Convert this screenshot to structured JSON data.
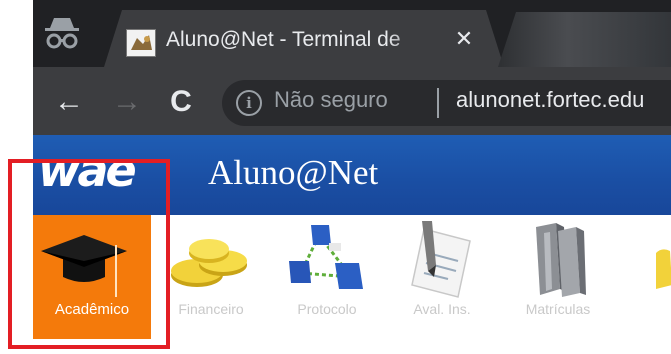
{
  "browser": {
    "tab": {
      "title": "Aluno@Net - Terminal de",
      "close_glyph": "✕",
      "favicon": "app-favicon-icon"
    },
    "nav": {
      "back_glyph": "←",
      "forward_glyph": "→",
      "reload_glyph": "C"
    },
    "address_bar": {
      "info_glyph": "i",
      "security_label": "Não seguro",
      "url": "alunonet.fortec.edu"
    }
  },
  "app": {
    "logo_text": "wae",
    "title": "Aluno@Net",
    "header_color": "#1a4ea3"
  },
  "menu": {
    "items": [
      {
        "label": "Acadêmico",
        "icon": "graduation-cap-icon",
        "active": true
      },
      {
        "label": "Financeiro",
        "icon": "coins-icon",
        "active": false
      },
      {
        "label": "Protocolo",
        "icon": "network-icon",
        "active": false
      },
      {
        "label": "Aval. Ins.",
        "icon": "document-signing-icon",
        "active": false
      },
      {
        "label": "Matrículas",
        "icon": "books-icon",
        "active": false
      }
    ],
    "active_color": "#f47a0b",
    "highlight_color": "#e31e24"
  }
}
